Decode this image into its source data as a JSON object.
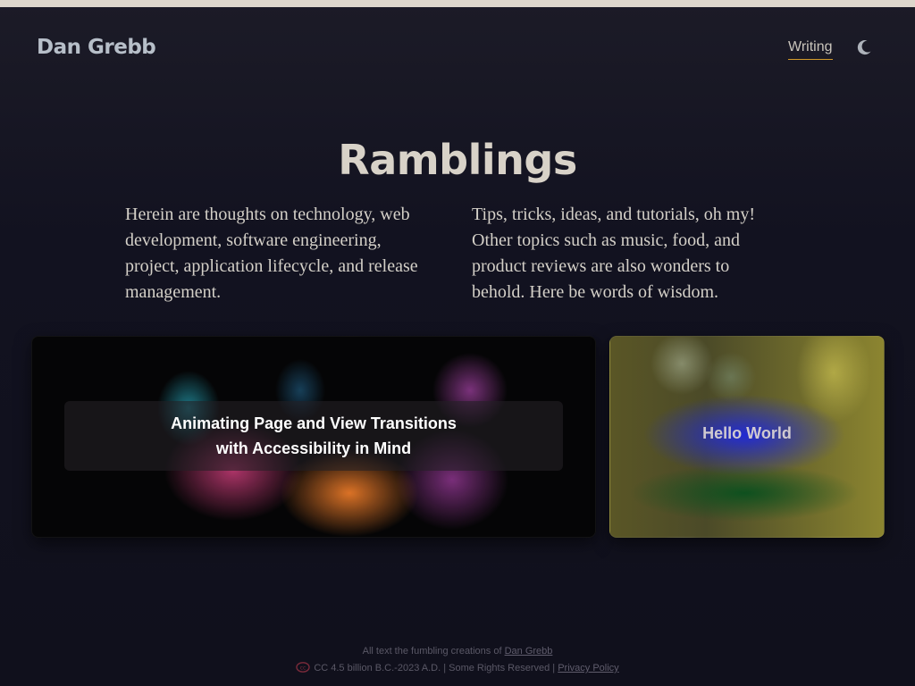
{
  "site": {
    "name": "Dan Grebb"
  },
  "nav": {
    "items": [
      {
        "label": "Writing",
        "active": true
      }
    ],
    "theme_toggle_icon": "moon-icon"
  },
  "colors": {
    "accent_underline": "#d39a2b",
    "top_bar": "#ddd6cc",
    "background": "#121220"
  },
  "page": {
    "title": "Ramblings",
    "intro_left": "Herein are thoughts on technology, web development, software engineering, project, application lifecycle, and release management.",
    "intro_right": "Tips, tricks, ideas, and tutorials, oh my! Other topics such as music, food, and product reviews are also wonders to behold. Here be words of wisdom."
  },
  "posts": [
    {
      "title": "Animating Page and View Transitions with Accessibility in Mind"
    },
    {
      "title": "Hello World"
    }
  ],
  "footer": {
    "line1_prefix": "All text the fumbling creations of ",
    "line1_link": "Dan Grebb",
    "cc_icon": "creative-commons-icon",
    "line2_text": "CC 4.5 billion B.C.-2023 A.D. | Some Rights Reserved | ",
    "line2_link": "Privacy Policy"
  }
}
